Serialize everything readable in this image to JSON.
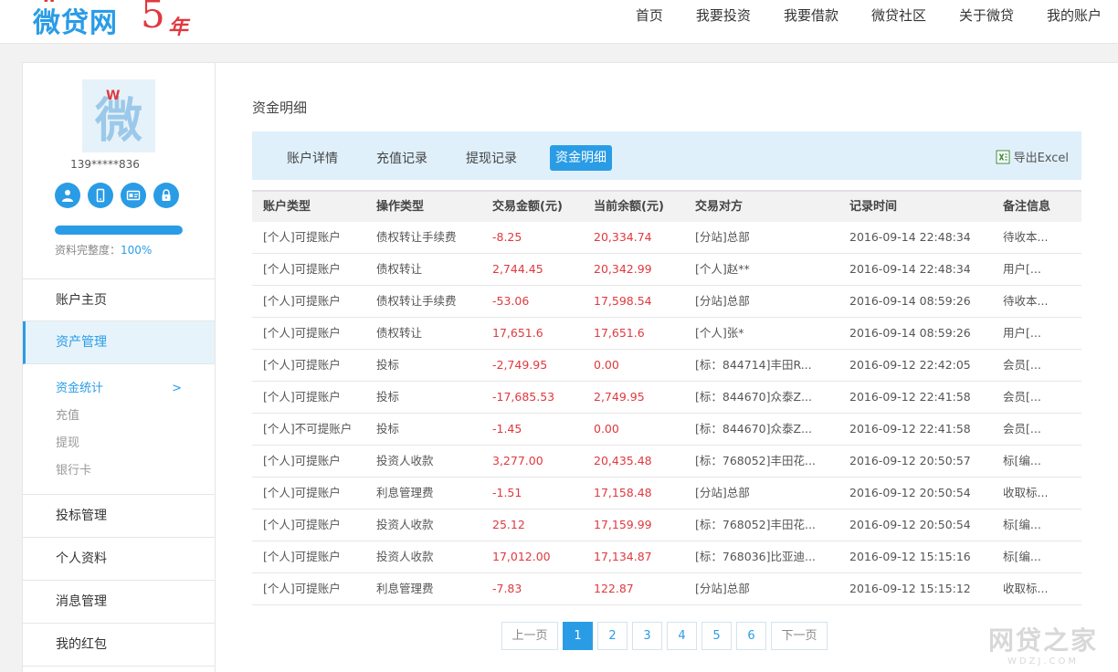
{
  "header": {
    "logo_text": "微贷网",
    "logo_years": "5",
    "logo_year_suffix": "年",
    "nav": [
      "首页",
      "我要投资",
      "我要借款",
      "微贷社区",
      "关于微贷",
      "我的账户"
    ]
  },
  "sidebar": {
    "avatar_char": "微",
    "avatar_badge": "W",
    "username": "139*****836",
    "verify_icons": [
      "user-icon",
      "phone-icon",
      "id-card-icon",
      "lock-icon"
    ],
    "profile_progress": 1.0,
    "profile_label": "资料完整度：",
    "profile_pct": "100%",
    "menu": {
      "home": "账户主页",
      "assets": "资产管理",
      "sub": {
        "stats": "资金统计",
        "stats_arrow": ">",
        "recharge": "充值",
        "withdraw": "提现",
        "bankcard": "银行卡"
      },
      "bids": "投标管理",
      "profile": "个人资料",
      "messages": "消息管理",
      "redpacket": "我的红包"
    }
  },
  "main": {
    "title": "资金明细",
    "tabs": [
      "账户详情",
      "充值记录",
      "提现记录",
      "资金明细"
    ],
    "export_label": "导出Excel",
    "columns": [
      "账户类型",
      "操作类型",
      "交易金额(元)",
      "当前余额(元)",
      "交易对方",
      "记录时间",
      "备注信息"
    ],
    "rows": [
      [
        "[个人]可提账户",
        "债权转让手续费",
        "-8.25",
        "20,334.74",
        "[分站]总部",
        "2016-09-14 22:48:34",
        "待收本..."
      ],
      [
        "[个人]可提账户",
        "债权转让",
        "2,744.45",
        "20,342.99",
        "[个人]赵**",
        "2016-09-14 22:48:34",
        "用户[..."
      ],
      [
        "[个人]可提账户",
        "债权转让手续费",
        "-53.06",
        "17,598.54",
        "[分站]总部",
        "2016-09-14 08:59:26",
        "待收本..."
      ],
      [
        "[个人]可提账户",
        "债权转让",
        "17,651.6",
        "17,651.6",
        "[个人]张*",
        "2016-09-14 08:59:26",
        "用户[..."
      ],
      [
        "[个人]可提账户",
        "投标",
        "-2,749.95",
        "0.00",
        "[标：844714]丰田R...",
        "2016-09-12 22:42:05",
        "会员[..."
      ],
      [
        "[个人]可提账户",
        "投标",
        "-17,685.53",
        "2,749.95",
        "[标：844670]众泰Z...",
        "2016-09-12 22:41:58",
        "会员[..."
      ],
      [
        "[个人]不可提账户",
        "投标",
        "-1.45",
        "0.00",
        "[标：844670]众泰Z...",
        "2016-09-12 22:41:58",
        "会员[..."
      ],
      [
        "[个人]可提账户",
        "投资人收款",
        "3,277.00",
        "20,435.48",
        "[标：768052]丰田花...",
        "2016-09-12 20:50:57",
        "标[编..."
      ],
      [
        "[个人]可提账户",
        "利息管理费",
        "-1.51",
        "17,158.48",
        "[分站]总部",
        "2016-09-12 20:50:54",
        "收取标..."
      ],
      [
        "[个人]可提账户",
        "投资人收款",
        "25.12",
        "17,159.99",
        "[标：768052]丰田花...",
        "2016-09-12 20:50:54",
        "标[编..."
      ],
      [
        "[个人]可提账户",
        "投资人收款",
        "17,012.00",
        "17,134.87",
        "[标：768036]比亚迪...",
        "2016-09-12 15:15:16",
        "标[编..."
      ],
      [
        "[个人]可提账户",
        "利息管理费",
        "-7.83",
        "122.87",
        "[分站]总部",
        "2016-09-12 15:15:12",
        "收取标..."
      ]
    ],
    "pager": {
      "prev": "上一页",
      "pages": [
        "1",
        "2",
        "3",
        "4",
        "5",
        "6"
      ],
      "current": "1",
      "next": "下一页"
    }
  },
  "watermark": {
    "big": "网贷之家",
    "small": "WDZJ.COM"
  },
  "colors": {
    "accent": "#2a9ce6",
    "amount": "#e0393e",
    "tab_bar": "#dff0fb"
  }
}
